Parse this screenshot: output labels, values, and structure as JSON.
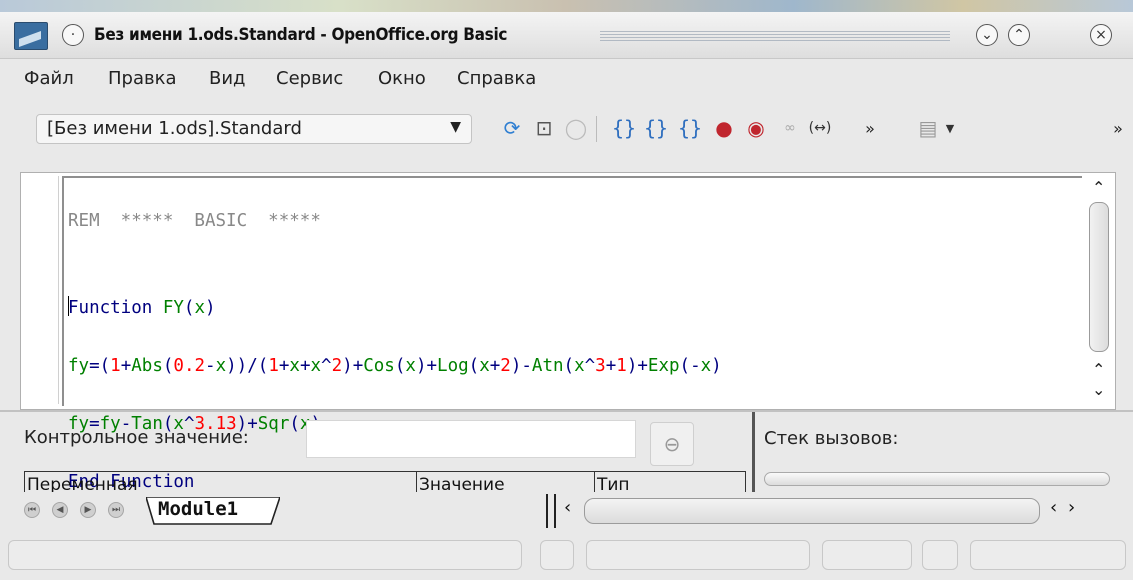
{
  "window": {
    "title": "Без имени 1.ods.Standard - OpenOffice.org Basic"
  },
  "menu": [
    {
      "label": "Файл"
    },
    {
      "label": "Правка"
    },
    {
      "label": "Вид"
    },
    {
      "label": "Сервис"
    },
    {
      "label": "Окно"
    },
    {
      "label": "Справка"
    }
  ],
  "toolbar": {
    "library_select_value": "[Без имени 1.ods].Standard",
    "icons": [
      "compile-icon",
      "run-icon",
      "stop-icon",
      "step-into-icon",
      "step-over-icon",
      "step-out-icon",
      "breakpoint-icon",
      "manage-breakpoints-icon",
      "watch-icon",
      "find-parentheses-icon",
      "more-icon",
      "insert-basic-source-icon",
      "more-icon"
    ]
  },
  "editor": {
    "lines": [
      "REM  *****  BASIC  *****",
      "",
      "Function FY(x)",
      "fy=(1+Abs(0.2-x))/(1+x+x^2)+Cos(x)+Log(x+2)-Atn(x^3+1)+Exp(-x)",
      "fy=fy-Tan(x^3.13)+Sqr(x)",
      "End Function"
    ]
  },
  "watch": {
    "label": "Контрольное значение:",
    "input_value": "",
    "columns": [
      "Переменная",
      "Значение",
      "Тип"
    ]
  },
  "call_stack": {
    "label": "Стек вызовов:"
  },
  "tabs": {
    "module_tab": "Module1"
  },
  "colors": {
    "comment": "#888888",
    "keyword": "#00007f",
    "identifier": "#008000",
    "number": "#ff0000"
  }
}
